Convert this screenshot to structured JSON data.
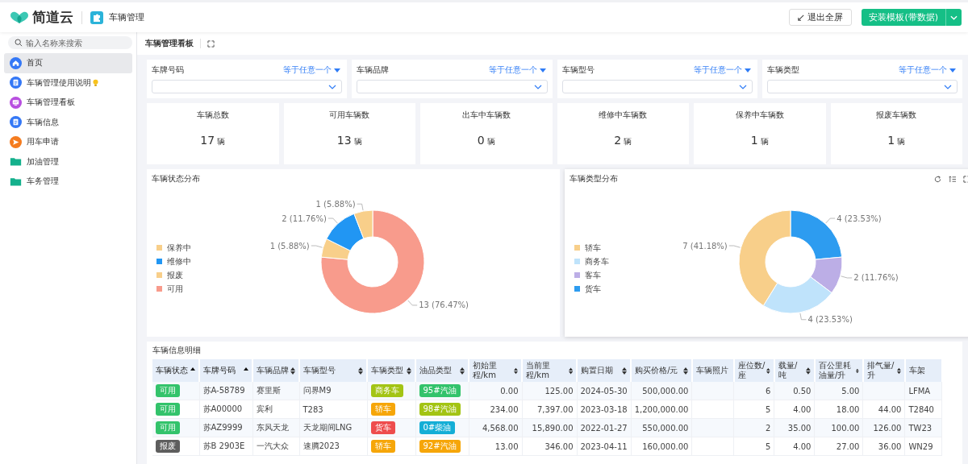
{
  "header": {
    "logo_text": "简道云",
    "app_name": "车辆管理",
    "buttons": [
      {
        "kind": "exit",
        "label": "退出全屏"
      },
      {
        "kind": "primary",
        "label": "安装模板(带数据)"
      }
    ]
  },
  "sidebar": {
    "search": {
      "placeholder": "输入名称来搜索"
    },
    "items": [
      {
        "label": "首页",
        "kind": "home",
        "selected": true,
        "tip": false
      },
      {
        "label": "车辆管理使用说明",
        "kind": "doc",
        "selected": false,
        "tip": true
      },
      {
        "label": "车辆管理看板",
        "kind": "board",
        "selected": false,
        "tip": false
      },
      {
        "label": "车辆信息",
        "kind": "doc",
        "selected": false,
        "tip": false
      },
      {
        "label": "用车申请",
        "kind": "send",
        "selected": false,
        "tip": false
      },
      {
        "label": "加油管理",
        "kind": "folder",
        "selected": false,
        "tip": false
      },
      {
        "label": "车务管理",
        "kind": "folder",
        "selected": false,
        "tip": false
      }
    ]
  },
  "page": {
    "title": "车辆管理看板"
  },
  "filters": [
    {
      "label": "车牌号码",
      "mode": "等于任意一个"
    },
    {
      "label": "车辆品牌",
      "mode": "等于任意一个"
    },
    {
      "label": "车辆型号",
      "mode": "等于任意一个"
    },
    {
      "label": "车辆类型",
      "mode": "等于任意一个"
    }
  ],
  "stats": [
    {
      "title": "车辆总数",
      "value": "17",
      "unit": "辆"
    },
    {
      "title": "可用车辆数",
      "value": "13",
      "unit": "辆"
    },
    {
      "title": "出车中车辆数",
      "value": "0",
      "unit": "辆"
    },
    {
      "title": "维修中车辆数",
      "value": "2",
      "unit": "辆"
    },
    {
      "title": "保养中车辆数",
      "value": "1",
      "unit": "辆"
    },
    {
      "title": "报废车辆数",
      "value": "1",
      "unit": "辆"
    }
  ],
  "charts": [
    {
      "title": "车辆状态分布",
      "tools": false,
      "chart_data": {
        "type": "donut",
        "legend": "left",
        "categories": [
          "保养中",
          "维修中",
          "报废",
          "可用"
        ],
        "colors": [
          "#f8cf8a",
          "#2196f3",
          "#f8cf8a",
          "#f89b8c"
        ],
        "values": [
          1,
          2,
          1,
          13
        ],
        "value_labels": [
          "1 (5.88%)",
          "2 (11.76%)",
          "1 (5.88%)",
          "13 (76.47%)"
        ]
      }
    },
    {
      "title": "车辆类型分布",
      "tools": true,
      "chart_data": {
        "type": "donut",
        "legend": "left",
        "categories": [
          "轿车",
          "商务车",
          "客车",
          "货车"
        ],
        "colors": [
          "#f8cf8a",
          "#bfe3fb",
          "#bcaee6",
          "#2d9cf0"
        ],
        "values": [
          7,
          4,
          2,
          4
        ],
        "value_labels": [
          "7 (41.18%)",
          "4 (23.53%)",
          "2 (11.76%)",
          "4 (23.53%)"
        ]
      }
    }
  ],
  "table": {
    "title": "车辆信息明细",
    "columns": [
      {
        "label": "车辆状态",
        "kind": "tag",
        "sortable": true,
        "sorted": true
      },
      {
        "label": "车牌号码",
        "kind": "text",
        "sortable": true,
        "sorted": true
      },
      {
        "label": "车辆品牌",
        "kind": "text",
        "sortable": true,
        "sorted": false
      },
      {
        "label": "车辆型号",
        "kind": "text",
        "sortable": true,
        "sorted": false
      },
      {
        "label": "车辆类型",
        "kind": "tag",
        "sortable": true,
        "sorted": false
      },
      {
        "label": "油品类型",
        "kind": "tag",
        "sortable": true,
        "sorted": false
      },
      {
        "label": "初始里程/km",
        "kind": "number",
        "sortable": true,
        "sorted": false
      },
      {
        "label": "当前里程/km",
        "kind": "number",
        "sortable": true,
        "sorted": false
      },
      {
        "label": "购置日期",
        "kind": "text",
        "sortable": true,
        "sorted": false
      },
      {
        "label": "购买价格/元",
        "kind": "number",
        "sortable": true,
        "sorted": false
      },
      {
        "label": "车辆照片",
        "kind": "text",
        "sortable": false,
        "sorted": false
      },
      {
        "label": "座位数/座",
        "kind": "number",
        "sortable": true,
        "sorted": false
      },
      {
        "label": "载量/吨",
        "kind": "number",
        "sortable": true,
        "sorted": false
      },
      {
        "label": "百公里耗油量/升",
        "kind": "number",
        "sortable": true,
        "sorted": false
      },
      {
        "label": "排气量/升",
        "kind": "number",
        "sortable": true,
        "sorted": false
      },
      {
        "label": "车架",
        "kind": "text",
        "sortable": false,
        "sorted": false
      }
    ],
    "rows": [
      {
        "cells": [
          {
            "text": "可用",
            "color": "#33c36b"
          },
          "苏A-58789",
          "赛里斯",
          "问界M9",
          {
            "text": "商务车",
            "color": "#a3c414"
          },
          {
            "text": "95#汽油",
            "color": "#33c36b"
          },
          "0.00",
          "125.00",
          "2024-05-30",
          "500,000.00",
          "",
          "6",
          "0.50",
          "5.00",
          "",
          "LFMA"
        ]
      },
      {
        "cells": [
          {
            "text": "可用",
            "color": "#33c36b"
          },
          "苏A00000",
          "宾利",
          "T283",
          {
            "text": "轿车",
            "color": "#f6a609"
          },
          {
            "text": "98#汽油",
            "color": "#a3c414"
          },
          "234.00",
          "7,397.00",
          "2023-03-18",
          "1,200,000.00",
          "",
          "5",
          "4.00",
          "18.00",
          "44.00",
          "T2840"
        ]
      },
      {
        "cells": [
          {
            "text": "可用",
            "color": "#33c36b"
          },
          "苏AZ9999",
          "东风天龙",
          "天龙期间LNG",
          {
            "text": "货车",
            "color": "#ee4d4d"
          },
          {
            "text": "0#柴油",
            "color": "#14aed6"
          },
          "4,568.00",
          "15,890.00",
          "2022-01-27",
          "550,000.00",
          "",
          "2",
          "35.00",
          "100.00",
          "126.00",
          "TW23"
        ]
      },
      {
        "cells": [
          {
            "text": "报废",
            "color": "#5e5e5e"
          },
          "苏B 2903E",
          "一汽大众",
          "速腾2023",
          {
            "text": "轿车",
            "color": "#f6a609"
          },
          {
            "text": "92#汽油",
            "color": "#f6a609"
          },
          "13.00",
          "346.00",
          "2023-04-11",
          "160,000.00",
          "",
          "5",
          "4.00",
          "27.00",
          "36.00",
          "WN29"
        ]
      }
    ]
  }
}
